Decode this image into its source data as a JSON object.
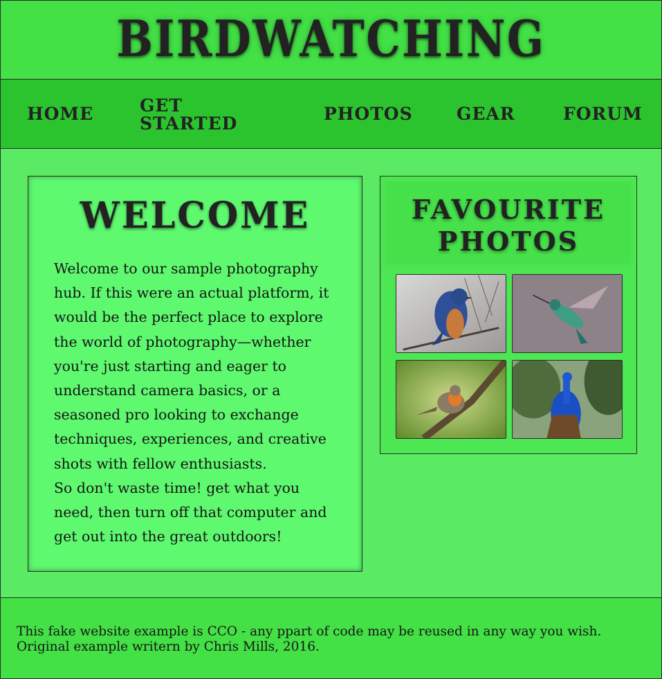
{
  "header": {
    "title": "BIRDWATCHING"
  },
  "nav": {
    "items": [
      {
        "label": "HOME"
      },
      {
        "label": "GET STARTED"
      },
      {
        "label": "PHOTOS"
      },
      {
        "label": "GEAR"
      },
      {
        "label": "FORUM"
      }
    ]
  },
  "main": {
    "title": "WELCOME",
    "paragraphs": [
      "Welcome to our sample photography hub. If this were an actual platform, it would be the perfect place to explore the world of photography—whether you're just starting and eager to understand camera basics, or a seasoned pro looking to exchange techniques, experiences, and creative shots with fellow enthusiasts.",
      "So don't waste time! get what you need, then turn off that computer and get out into the great outdoors!"
    ]
  },
  "sidebar": {
    "title": "FAVOURITE PHOTOS",
    "photos": [
      {
        "icon": "bluebird-photo"
      },
      {
        "icon": "hummingbird-photo"
      },
      {
        "icon": "robin-photo"
      },
      {
        "icon": "peacock-photo"
      }
    ]
  },
  "footer": {
    "text": "This fake website example is CCO - any ppart of code may be reused in any way you wish. Original example writern by Chris Mills, 2016."
  },
  "colors": {
    "header_bg": "#43e046",
    "nav_bg": "#2bc42f",
    "body_bg": "#5bea63",
    "main_panel_bg": "#5ef96f",
    "footer_bg": "#43e046"
  }
}
